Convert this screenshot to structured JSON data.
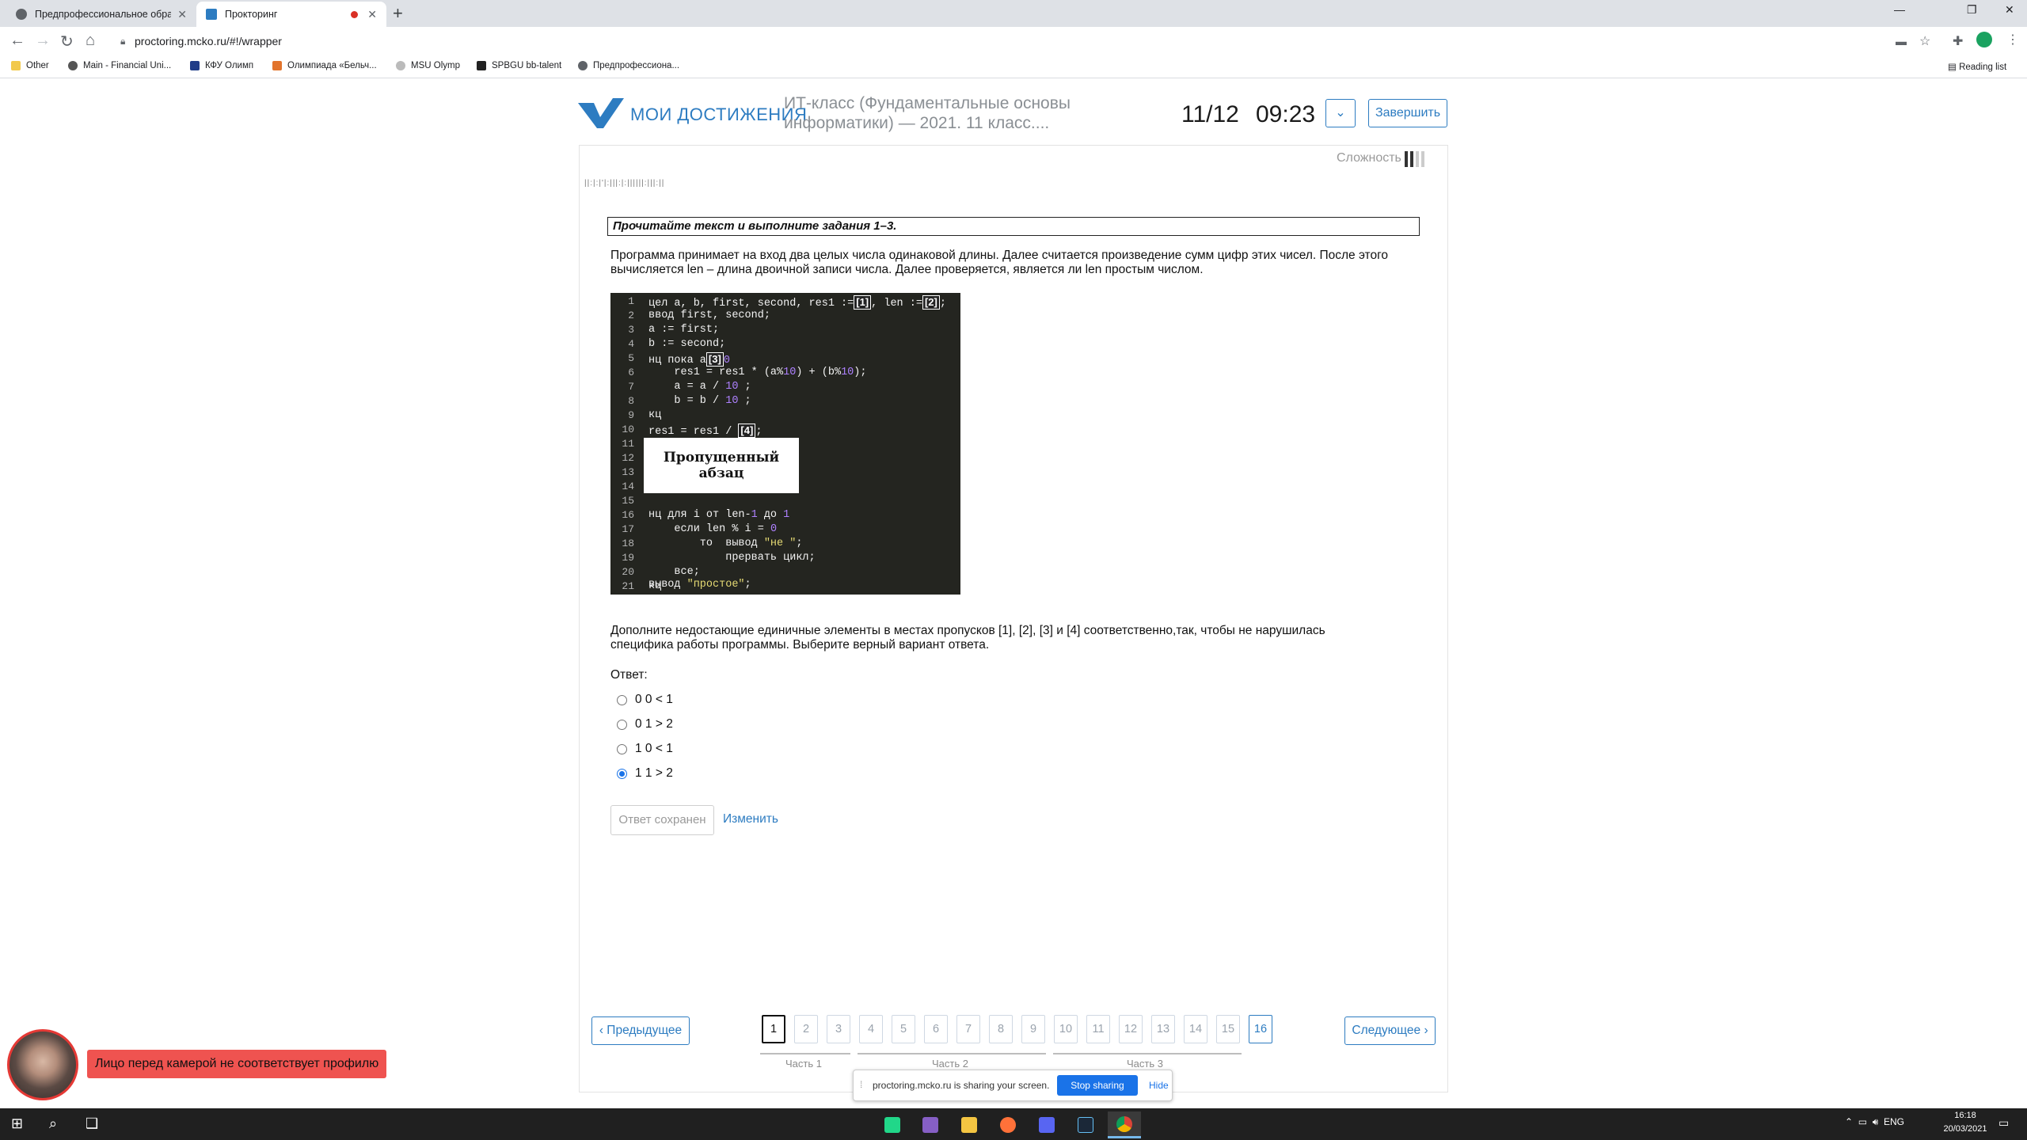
{
  "browser": {
    "tabs": [
      {
        "title": "Предпрофессиональное образ",
        "active": false
      },
      {
        "title": "Прокторинг",
        "active": true
      }
    ],
    "url": "proctoring.mcko.ru/#!/wrapper",
    "bookmarks": [
      "Other",
      "Main - Financial Uni...",
      "КФУ Олимп",
      "Олимпиада «Бельч...",
      "MSU Olymp",
      "SPBGU bb-talent",
      "Предпрофессиона..."
    ],
    "reading_list": "Reading list"
  },
  "header": {
    "logo_text": "МОИ ДОСТИЖЕНИЯ",
    "exam_title": "ИТ-класс (Фундаментальные основы информатики) — 2021. 11 класс....",
    "task_counter": "11/12",
    "timer": "09:23",
    "dropdown_icon": "chevron-down-icon",
    "finish_label": "Завершить"
  },
  "task": {
    "difficulty_label": "Сложность",
    "difficulty_level": 2,
    "difficulty_max": 4,
    "instruction": "Прочитайте текст и выполните задания 1–3.",
    "paragraph": "Программа принимает на вход два целых числа одинаковой длины. Далее считается произведение сумм цифр этих чисел. После этого вычисляется len – длина двоичной записи числа. Далее проверяется, является ли len простым числом.",
    "missing_block": "Пропущенный абзац",
    "question": "Дополните недостающие единичные элементы в местах пропусков [1], [2], [3] и [4] соответственно,так, чтобы не нарушилась специфика работы программы. Выберите верный вариант ответа.",
    "answer_label": "Ответ:",
    "options": [
      {
        "label": "0 0 < 1",
        "selected": false
      },
      {
        "label": "0 1 > 2",
        "selected": false
      },
      {
        "label": "1 0 < 1",
        "selected": false
      },
      {
        "label": "1 1 > 2",
        "selected": true
      }
    ],
    "saved_label": "Ответ сохранен",
    "change_label": "Изменить"
  },
  "code": {
    "line_numbers": [
      "1",
      "2",
      "3",
      "4",
      "5",
      "6",
      "7",
      "8",
      "9",
      "10",
      "11",
      "12",
      "13",
      "14",
      "15",
      "16",
      "17",
      "18",
      "19",
      "20",
      "21"
    ],
    "l1a": "цел a, b, first, second, res1 :=",
    "b1": "[1]",
    "l1b": ", len :=",
    "b2": "[2]",
    "l1c": ";",
    "l2": "ввод first, second;",
    "l3": "a := first;",
    "l4": "b := second;",
    "l5a": "нц пока a",
    "b3": "[3]",
    "l5b": "0",
    "l6a": "    res1 = res1 * (a%",
    "l6n1": "10",
    "l6b": ") + (b%",
    "l6n2": "10",
    "l6c": ");",
    "l7a": "    a = a / ",
    "l7n": "10",
    "l7b": " ;",
    "l8a": "    b = b / ",
    "l8n": "10",
    "l8b": " ;",
    "l9": "кц",
    "l10a": "res1 = res1 / ",
    "b4": "[4]",
    "l10b": ";",
    "l15a": "нц для i от len-",
    "l15n1": "1",
    "l15b": " до ",
    "l15n2": "1",
    "l16a": "    если len % i = ",
    "l16n": "0",
    "l17a": "        то  вывод ",
    "l17s": "\"не \"",
    "l17b": ";",
    "l18": "            прервать цикл;",
    "l19": "    все;",
    "l20": "кц",
    "l21a": "вывод ",
    "l21s": "\"простое\"",
    "l21b": ";"
  },
  "pager": {
    "prev_label": "‹ Предыдущее",
    "next_label": "Следующее ›",
    "pages": [
      "1",
      "2",
      "3",
      "4",
      "5",
      "6",
      "7",
      "8",
      "9",
      "10",
      "11",
      "12",
      "13",
      "14",
      "15",
      "16"
    ],
    "current": "1",
    "parts": [
      "Часть 1",
      "Часть 2",
      "Часть 3"
    ]
  },
  "sharing": {
    "text": "proctoring.mcko.ru is sharing your screen.",
    "stop_label": "Stop sharing",
    "hide_label": "Hide"
  },
  "proctor": {
    "warning": "Лицо перед камерой не соответствует профилю"
  },
  "taskbar": {
    "language": "ENG",
    "time": "16:18",
    "date": "20/03/2021"
  },
  "colors": {
    "brand_blue": "#2d7cc1",
    "code_bg": "#242520",
    "warning_red": "#ef5350",
    "stop_sharing_blue": "#1a73e8"
  }
}
